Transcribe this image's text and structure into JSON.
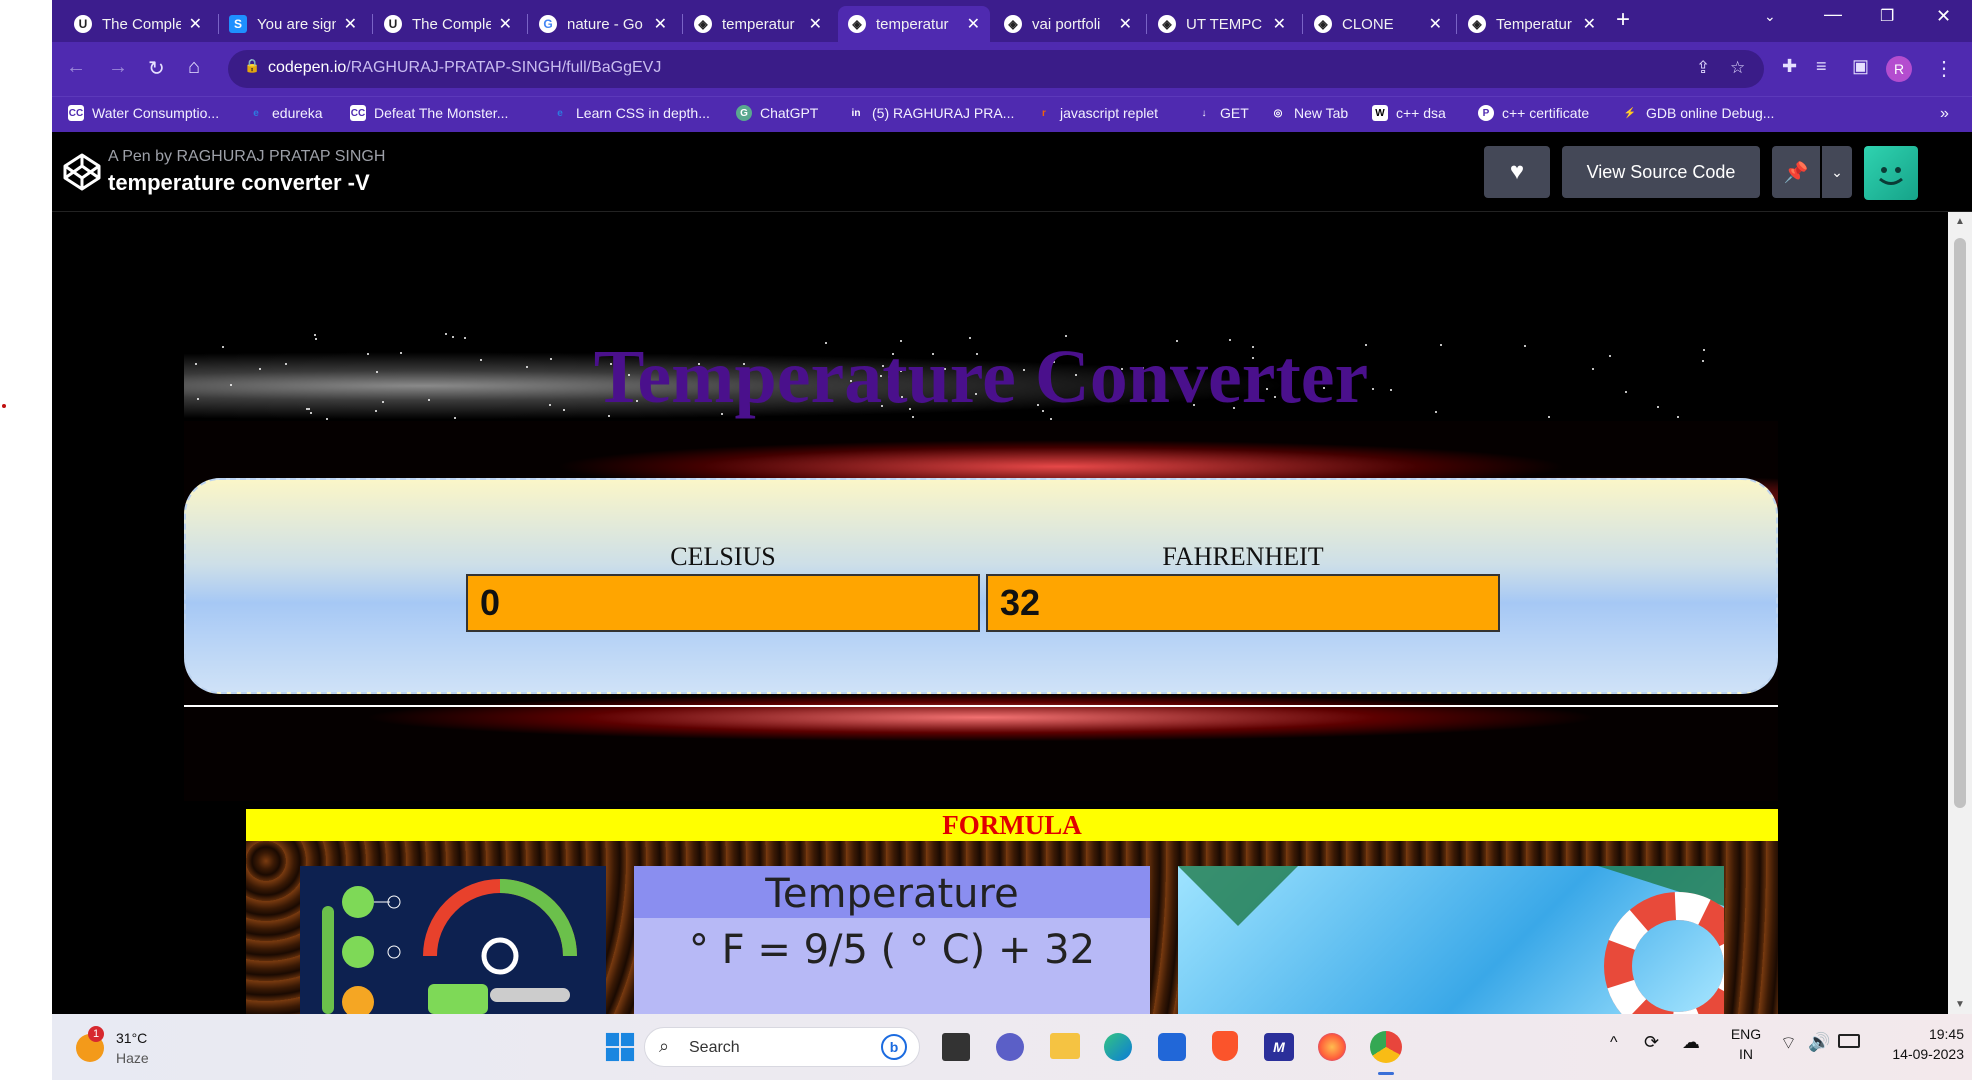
{
  "browser": {
    "tabs": [
      {
        "title": "The Comple",
        "icon": "u-icon",
        "active": false
      },
      {
        "title": "You are sign",
        "icon": "s-icon",
        "active": false
      },
      {
        "title": "The Comple",
        "icon": "u-icon",
        "active": false
      },
      {
        "title": "nature - Go",
        "icon": "google-icon",
        "active": false
      },
      {
        "title": "temperatur",
        "icon": "codepen-icon",
        "active": false
      },
      {
        "title": "temperatur",
        "icon": "codepen-icon",
        "active": true
      },
      {
        "title": "vai portfoli",
        "icon": "codepen-icon",
        "active": false
      },
      {
        "title": "UT TEMPC",
        "icon": "codepen-icon",
        "active": false
      },
      {
        "title": "CLONE",
        "icon": "codepen-icon",
        "active": false
      },
      {
        "title": "Temperatur",
        "icon": "codepen-icon",
        "active": false
      }
    ],
    "url_host": "codepen.io",
    "url_path": "/RAGHURAJ-PRATAP-SINGH/full/BaGgEVJ",
    "profile_initial": "R",
    "bookmarks": [
      {
        "label": "Water Consumptio...",
        "icon": "CC"
      },
      {
        "label": "edureka",
        "icon": "e"
      },
      {
        "label": "Defeat The Monster...",
        "icon": "CC"
      },
      {
        "label": "Learn CSS in depth...",
        "icon": "e"
      },
      {
        "label": "ChatGPT",
        "icon": "G"
      },
      {
        "label": "(5) RAGHURAJ PRA...",
        "icon": "in"
      },
      {
        "label": "javascript replet",
        "icon": "r"
      },
      {
        "label": "GET",
        "icon": "↓"
      },
      {
        "label": "New Tab",
        "icon": "◎"
      },
      {
        "label": "c++ dsa",
        "icon": "W"
      },
      {
        "label": "c++ certificate",
        "icon": "P"
      },
      {
        "label": "GDB online Debug...",
        "icon": "⚡"
      }
    ]
  },
  "codepen": {
    "by_line": "A Pen by RAGHURAJ PRATAP SINGH",
    "title": "temperature converter -V",
    "view_source_label": "View Source Code"
  },
  "converter": {
    "banner_title": "Temperature Converter",
    "celsius_label": "CELSIUS",
    "celsius_value": "0",
    "fahrenheit_label": "FAHRENHEIT",
    "fahrenheit_value": "32",
    "formula_heading": "FORMULA",
    "formula_image_title": "Temperature",
    "formula_image_eq": "° F = 9/5 ( ° C) + 32"
  },
  "taskbar": {
    "weather_temp": "31°C",
    "weather_desc": "Haze",
    "weather_badge": "1",
    "search_placeholder": "Search",
    "lang_top": "ENG",
    "lang_bottom": "IN",
    "time": "19:45",
    "date": "14-09-2023"
  }
}
